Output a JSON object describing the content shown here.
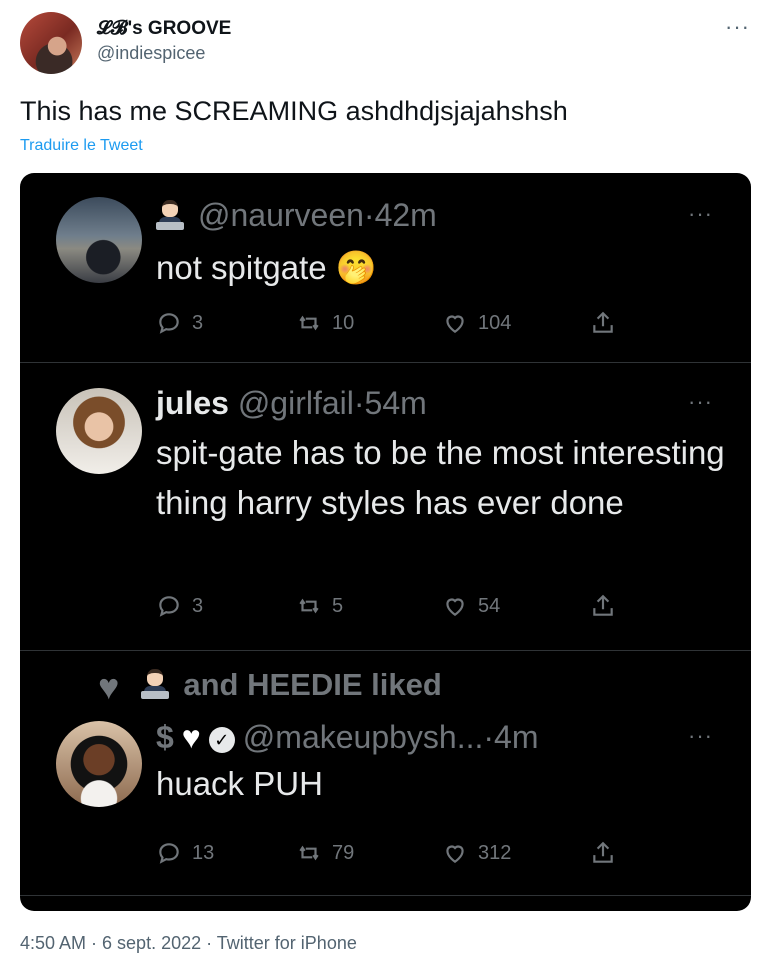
{
  "outer": {
    "name": "𝓛𝓑's GROOVE",
    "handle": "@indiespicee",
    "more": "···",
    "text": "This has me SCREAMING ashdhdjsjajahshsh",
    "translate": "Traduire le Tweet",
    "footer": "4:50 AM · 6 sept. 2022 · Twitter for iPhone"
  },
  "card": {
    "tweets": [
      {
        "display_name": "",
        "handle": "@naurveen",
        "time": "·42m",
        "text": "not spitgate 🤭",
        "more": "···",
        "replies": "3",
        "retweets": "10",
        "likes": "104"
      },
      {
        "display_name": "jules",
        "handle": "@girlfail",
        "time": "·54m",
        "text": "spit-gate has to be the most interesting thing harry styles has ever done",
        "more": "···",
        "replies": "3",
        "retweets": "5",
        "likes": "54"
      },
      {
        "liked_by": "and HEEDIE liked",
        "name_symbols": "$",
        "handle": "@makeupbysh...",
        "time": "·4m",
        "text": "huack PUH",
        "more": "···",
        "replies": "13",
        "retweets": "79",
        "likes": "312"
      }
    ]
  },
  "icons": [
    "more-icon",
    "reply-icon",
    "retweet-icon",
    "like-icon",
    "share-icon",
    "technologist-emoji",
    "verified-icon"
  ],
  "colors": {
    "link": "#1d9bf0",
    "dark_bg": "#000000",
    "muted": "#71767b"
  }
}
